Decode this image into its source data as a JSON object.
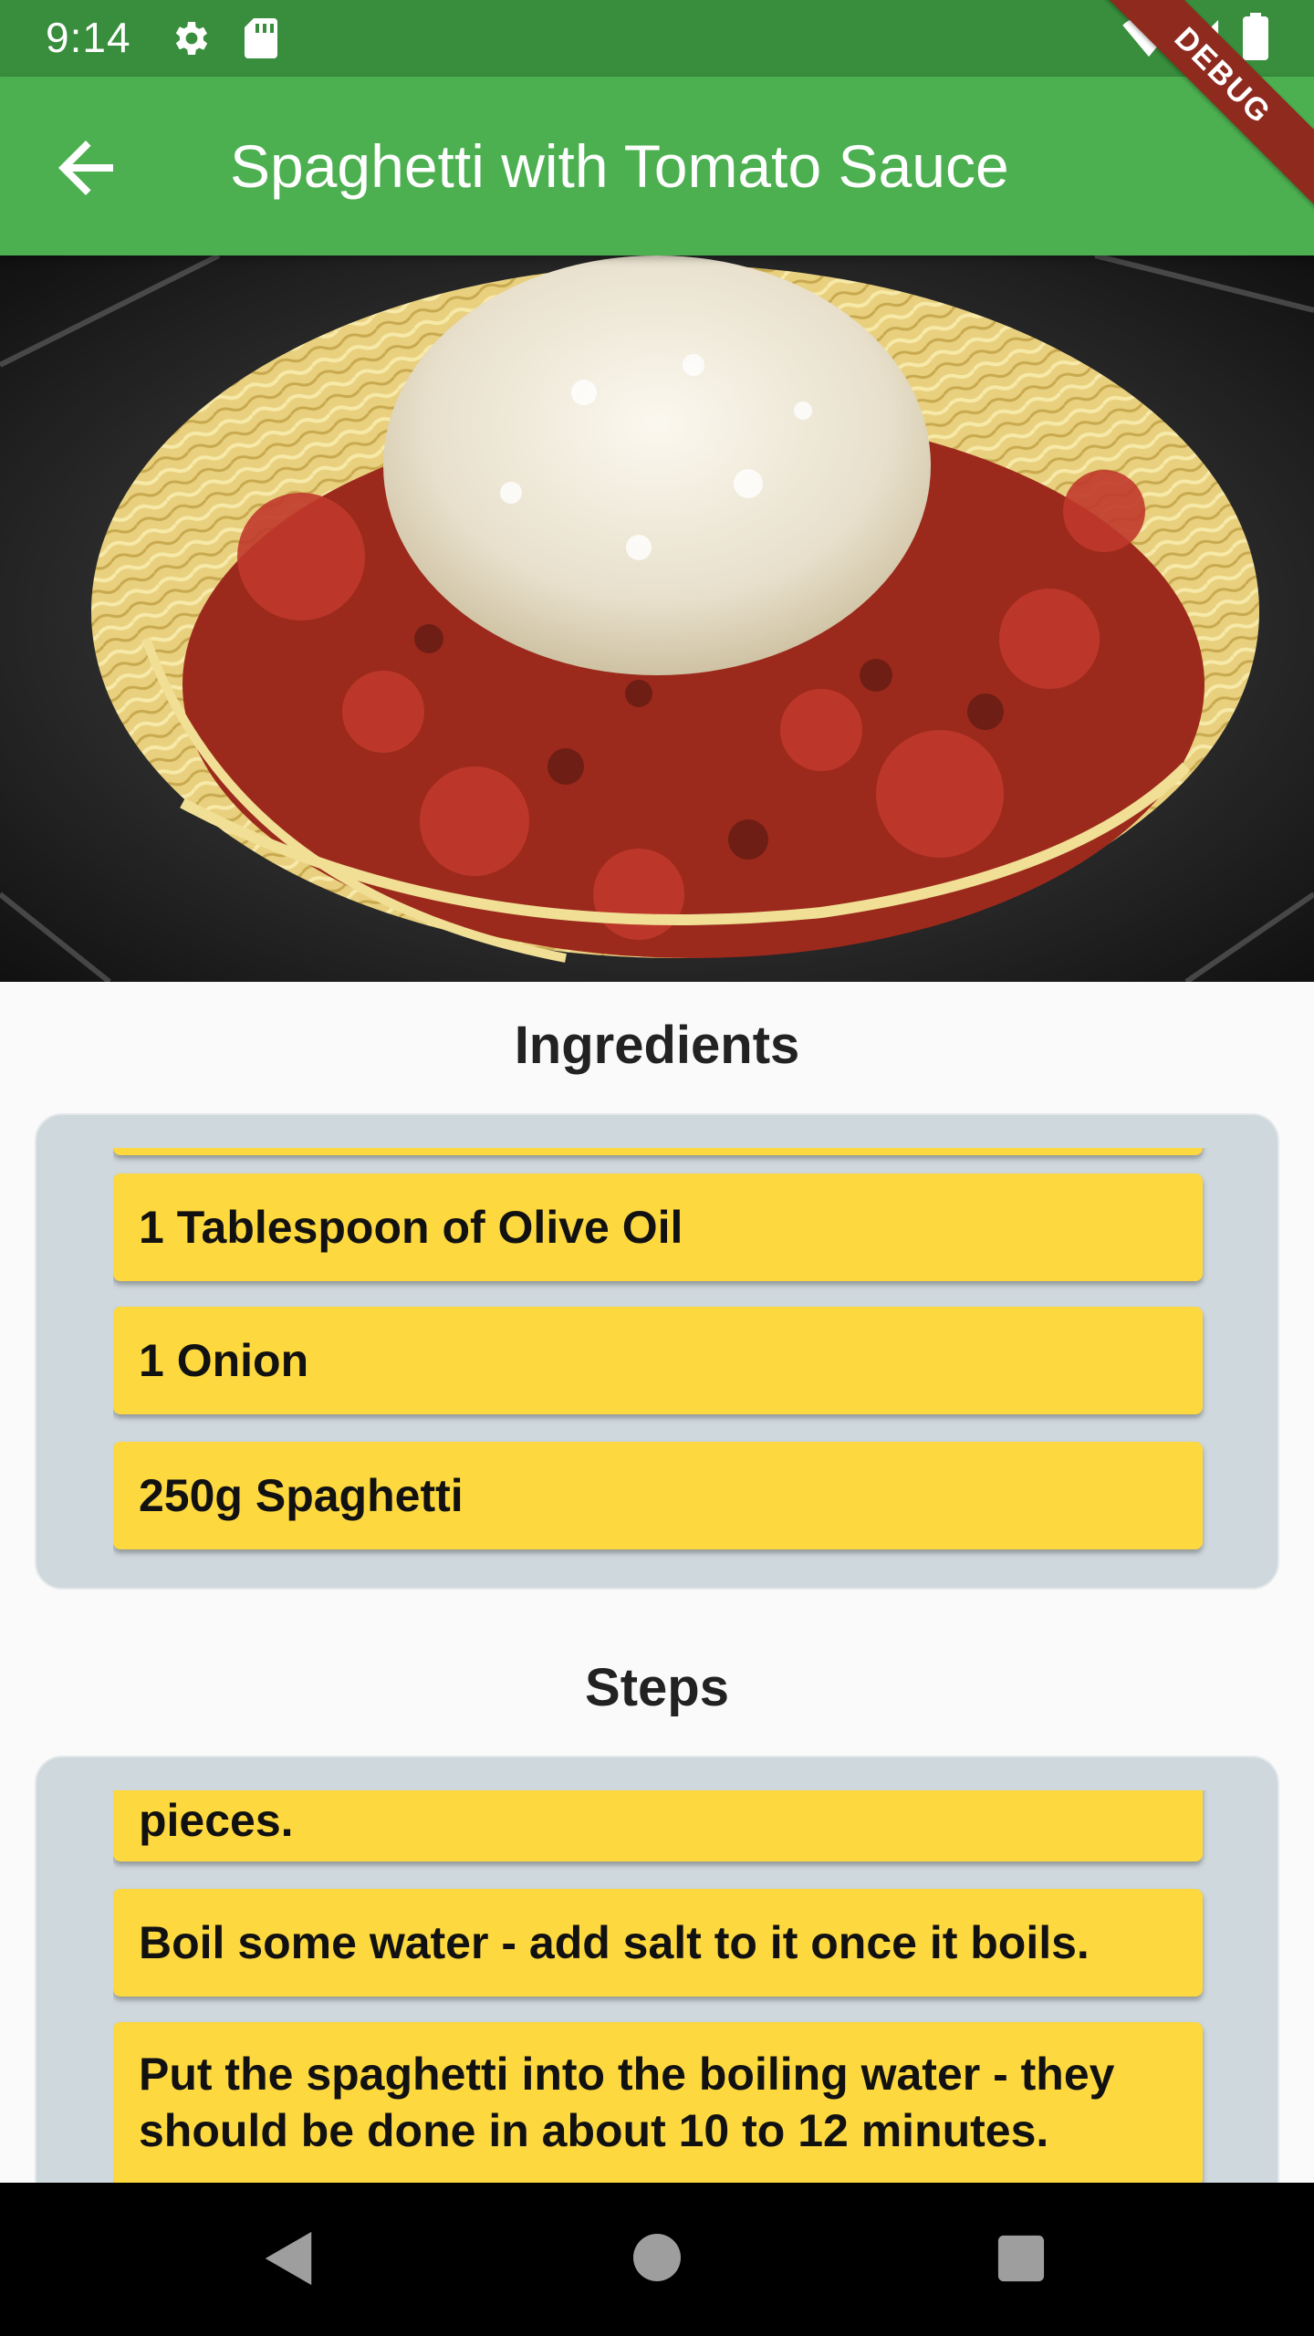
{
  "status_bar": {
    "time": "9:14"
  },
  "app_bar": {
    "title": "Spaghetti with Tomato Sauce",
    "back_icon": "arrow-left-icon"
  },
  "debug_banner": "DEBUG",
  "hero": {
    "icon": "spaghetti-photo"
  },
  "ingredients": {
    "title": "Ingredients",
    "items": [
      "",
      "1 Tablespoon of Olive Oil",
      "1 Onion",
      "250g Spaghetti"
    ]
  },
  "steps": {
    "title": "Steps",
    "items": [
      "pieces.",
      "Boil some water - add salt to it once it boils.",
      "Put the spaghetti into the boiling water - they should be done in about 10 to 12 minutes."
    ]
  },
  "colors": {
    "status_bar": "#388e3c",
    "app_bar": "#4caf50",
    "panel": "#cfd8dc",
    "card": "#fdd83f"
  }
}
